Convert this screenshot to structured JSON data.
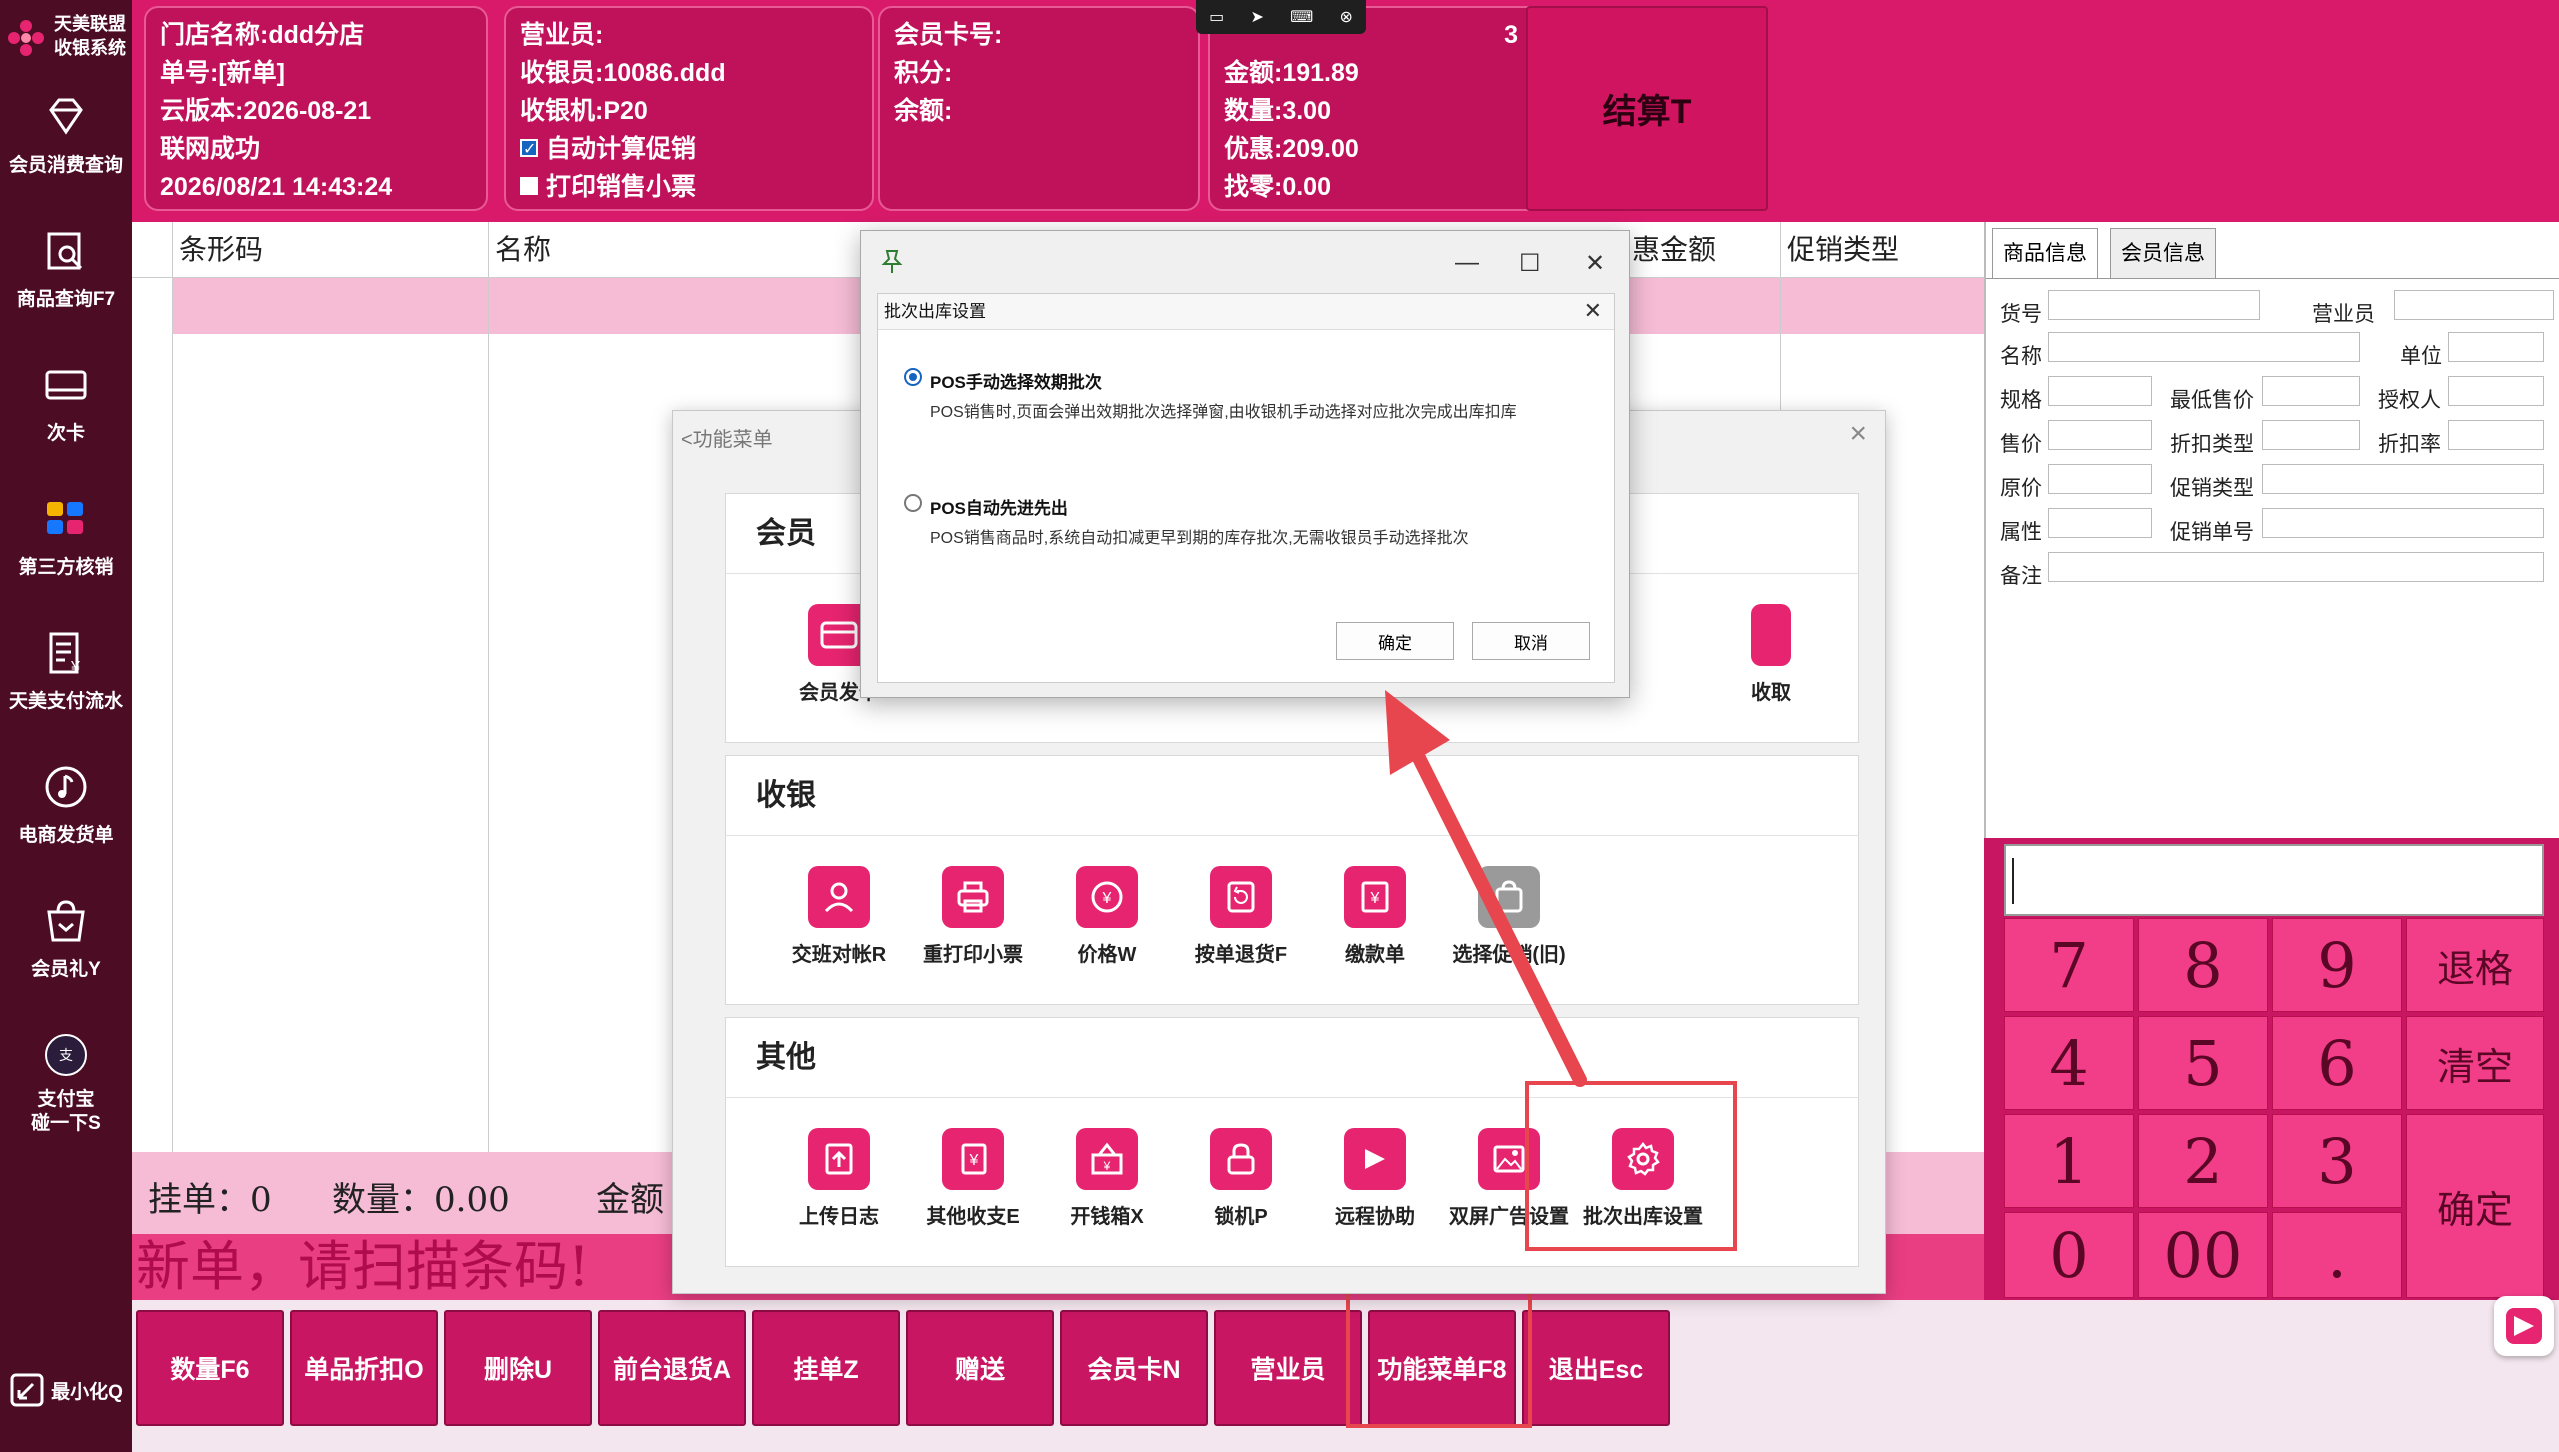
{
  "sidebar": {
    "brand": {
      "line1": "天美联盟",
      "line2": "收银系统"
    },
    "items": [
      {
        "label": "会员消费查询",
        "icon": "diamond-icon"
      },
      {
        "label": "商品查询F7",
        "icon": "search-doc-icon"
      },
      {
        "label": "次卡",
        "icon": "card-icon"
      },
      {
        "label": "第三方核销",
        "icon": "apps-icon"
      },
      {
        "label": "天美支付流水",
        "icon": "receipt-icon"
      },
      {
        "label": "电商发货单",
        "icon": "music-icon"
      },
      {
        "label": "会员礼Y",
        "icon": "gift-bag-icon"
      },
      {
        "label": "支付宝碰一下S",
        "icon": "alipay-icon"
      }
    ],
    "minimize": "最小化Q"
  },
  "top": {
    "store": {
      "store_name": "门店名称:ddd分店",
      "order_no": "单号:[新单]",
      "cloud_ver": "云版本:2026-08-21",
      "network": "联网成功",
      "datetime": "2026/08/21 14:43:24"
    },
    "cashier": {
      "clerk": "营业员:",
      "cashier": "收银员:10086.ddd",
      "machine": "收银机:P20",
      "auto_promo": "自动计算促销",
      "print_receipt": "打印销售小票"
    },
    "member": {
      "card_no": "会员卡号:",
      "points": "积分:",
      "balance": "余额:"
    },
    "totals": {
      "partial": "3",
      "amount": "金额:191.89",
      "qty": "数量:3.00",
      "discount": "优惠:209.00",
      "change": "找零:0.00"
    },
    "settle_label": "结算T"
  },
  "table": {
    "headers": [
      "条形码",
      "名称",
      "惠金额",
      "促销类型"
    ]
  },
  "status": {
    "hold": "挂单：0",
    "qty": "数量：0.00",
    "amount": "金额",
    "scan_prompt": "新单，请扫描条码!"
  },
  "bottom_buttons": [
    "数量F6",
    "单品折扣O",
    "删除U",
    "前台退货A",
    "挂单Z",
    "赠送",
    "会员卡N",
    "营业员",
    "功能菜单F8",
    "退出Esc"
  ],
  "right_panel": {
    "tabs": [
      "商品信息",
      "会员信息"
    ],
    "fields": [
      "货号",
      "营业员",
      "名称",
      "单位",
      "规格",
      "最低售价",
      "授权人",
      "售价",
      "折扣类型",
      "折扣率",
      "原价",
      "促销类型",
      "属性",
      "促销单号",
      "备注"
    ]
  },
  "keypad": {
    "keys": [
      "7",
      "8",
      "9",
      "退格",
      "4",
      "5",
      "6",
      "清空",
      "1",
      "2",
      "3",
      "确定",
      "0",
      "00",
      "."
    ]
  },
  "func_menu": {
    "title": "<功能菜单",
    "groups": [
      {
        "name": "会员",
        "items": [
          "会员发卡",
          "收取"
        ]
      },
      {
        "name": "收银",
        "items": [
          "交班对帐R",
          "重打印小票",
          "价格W",
          "按单退货F",
          "缴款单",
          "选择促销(旧)"
        ]
      },
      {
        "name": "其他",
        "items": [
          "上传日志",
          "其他收支E",
          "开钱箱X",
          "锁机P",
          "远程协助",
          "双屏广告设置",
          "批次出库设置"
        ]
      }
    ]
  },
  "batch_dialog": {
    "title": "批次出库设置",
    "opt1_title": "POS手动选择效期批次",
    "opt1_desc": "POS销售时,页面会弹出效期批次选择弹窗,由收银机手动选择对应批次完成出库扣库",
    "opt2_title": "POS自动先进先出",
    "opt2_desc": "POS销售商品时,系统自动扣减更早到期的库存批次,无需收银员手动选择批次",
    "ok": "确定",
    "cancel": "取消"
  },
  "colors": {
    "sidebar": "#4c0d24",
    "accent": "#d91a6a",
    "highlight_box": "#e8464f",
    "arrow": "#e8464f"
  }
}
